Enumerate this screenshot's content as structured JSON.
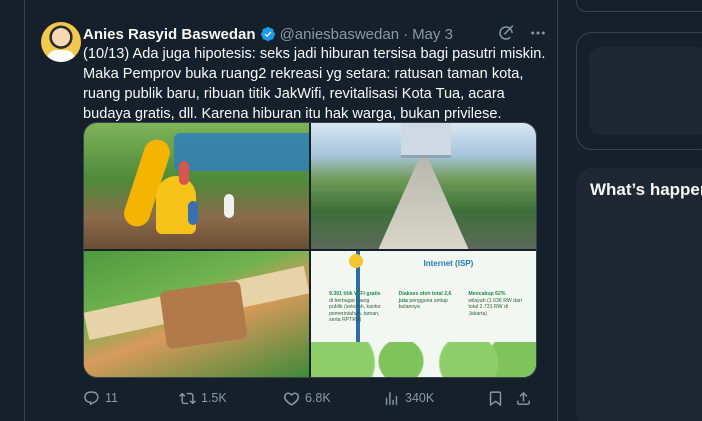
{
  "tweet": {
    "author_name": "Anies Rasyid Baswedan",
    "handle": "@aniesbaswedan",
    "separator": "·",
    "date": "May 3",
    "text": "(10/13) Ada juga hipotesis: seks jadi hiburan tersisa bagi pasutri miskin. Maka Pemprov buka ruang2 rekreasi yg setara: ratusan taman kota, ruang publik baru, ribuan titik JakWifi, revitalisasi Kota Tua, acara budaya gratis, dll. Karena hiburan itu hak warga, bukan privilese.",
    "verified_color": "#1d9bf0",
    "infographic": {
      "headline": "Internet (ISP)",
      "stats": [
        {
          "highlight": "9.301 titik WiFi gratis",
          "text": "di berbagai ruang publik (sekolah, kantor pemerintahan, taman, serta RPTRA)"
        },
        {
          "highlight": "Diakses oleh total 2,6 juta",
          "text": "pengguna setiap bulannya"
        },
        {
          "highlight": "Mencakup 62%",
          "text": "wilayah (1.636 RW dari total 2.731 RW di Jakarta)"
        }
      ]
    }
  },
  "actions": {
    "replies": "11",
    "retweets": "1.5K",
    "likes": "6.8K",
    "views": "340K"
  },
  "sidebar": {
    "trends_title": "What’s happening"
  },
  "colors": {
    "background": "#15202b",
    "text": "#f7f9f9",
    "muted": "#8b98a5",
    "border": "#38444d",
    "accent": "#1d9bf0"
  }
}
